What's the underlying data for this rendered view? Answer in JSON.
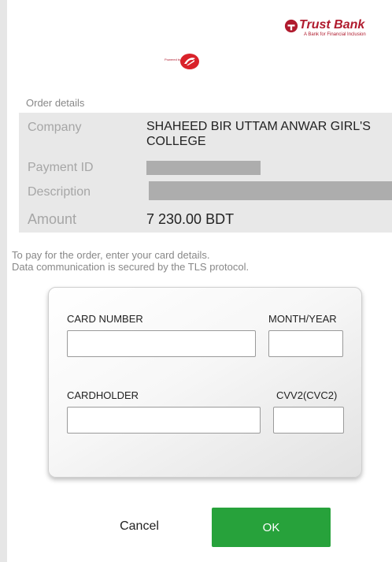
{
  "header": {
    "bank_name": "Trust Bank",
    "bank_tagline": "A Bank for Financial Inclusion",
    "powered_by_text": "Powered by",
    "brand_color": "#b01b2e"
  },
  "order": {
    "title": "Order details",
    "company_label": "Company",
    "company_value": "SHAHEED BIR UTTAM ANWAR GIRL'S COLLEGE",
    "payment_id_label": "Payment ID",
    "description_label": "Description",
    "amount_label": "Amount",
    "amount_value": "7 230.00 BDT"
  },
  "info": {
    "line1": "To pay for the order, enter your card details.",
    "line2": "Data communication is secured by the TLS protocol."
  },
  "card_form": {
    "card_number_label": "CARD NUMBER",
    "month_year_label": "MONTH/YEAR",
    "cardholder_label": "CARDHOLDER",
    "cvv_label": "CVV2(CVC2)",
    "card_number_value": "",
    "month_year_value": "",
    "cardholder_value": "",
    "cvv_value": ""
  },
  "buttons": {
    "cancel_label": "Cancel",
    "ok_label": "OK",
    "ok_color": "#27a23b"
  }
}
